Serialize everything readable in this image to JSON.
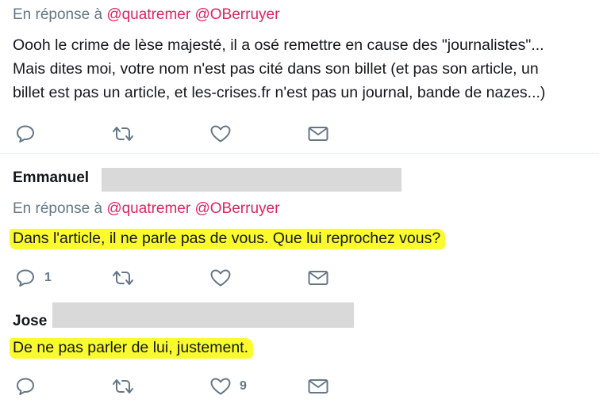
{
  "tweets": [
    {
      "reply_prefix": "En réponse à",
      "mentions": [
        "@quatremer",
        "@OBerruyer"
      ],
      "lines": [
        "Oooh le crime de lèse majesté, il a osé remettre en cause des \"journalistes\"...",
        "Mais dites moi, votre nom n'est pas cité dans son billet (et pas son article, un",
        "billet est pas un article, et les-crises.fr n'est pas un journal, bande de nazes...)"
      ],
      "reply_count": "",
      "like_count": ""
    },
    {
      "author": "Emmanuel",
      "reply_prefix": "En réponse à",
      "mentions": [
        "@quatremer",
        "@OBerruyer"
      ],
      "text": "Dans l'article, il ne parle pas de vous. Que lui reprochez vous?",
      "highlighted": true,
      "reply_count": "1",
      "like_count": ""
    },
    {
      "author": "Jose",
      "text": "De ne pas parler de lui, justement.",
      "highlighted": true,
      "reply_count": "",
      "like_count": "9"
    }
  ],
  "colors": {
    "mention": "#e0245e",
    "muted": "#657786",
    "highlight": "#fafa2e",
    "redaction": "#d9d9d9"
  },
  "icons": [
    "reply-icon",
    "retweet-icon",
    "like-icon",
    "direct-message-icon"
  ]
}
